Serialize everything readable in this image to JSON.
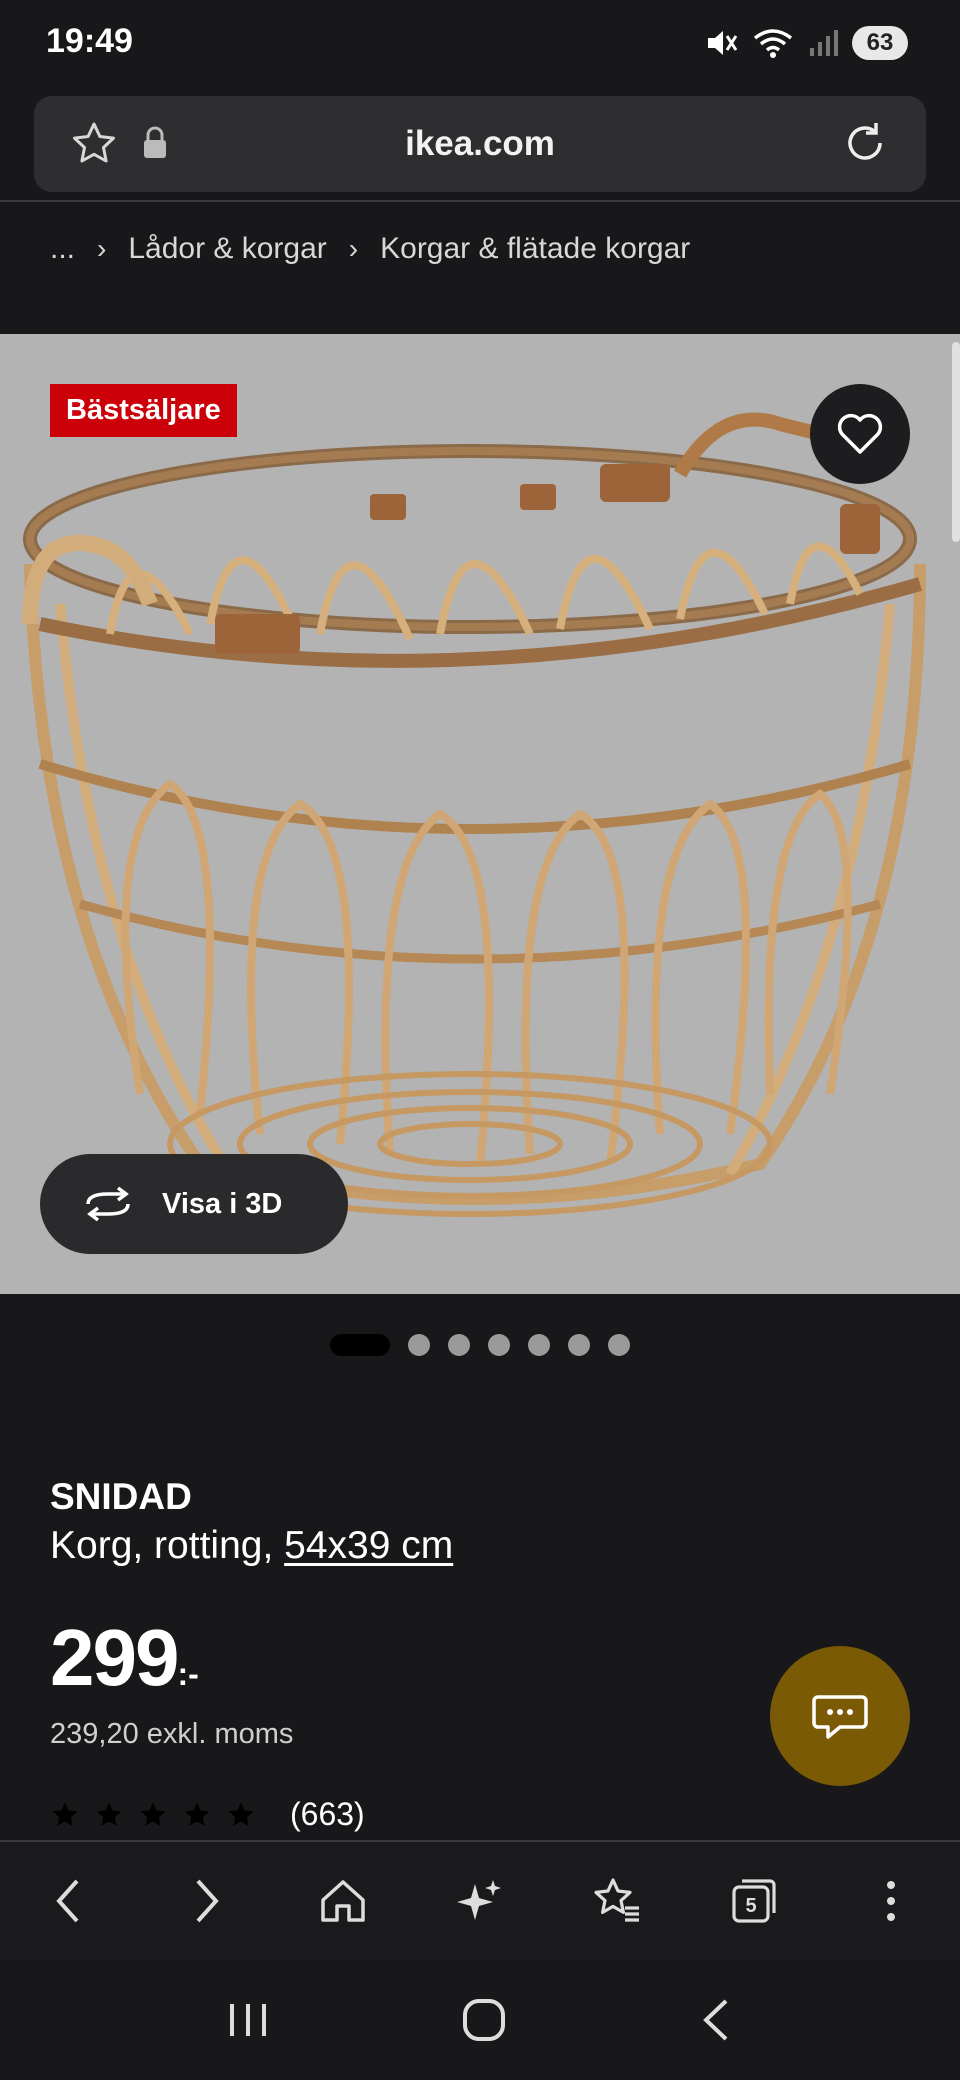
{
  "status_bar": {
    "time": "19:49",
    "battery": "63"
  },
  "browser": {
    "url": "ikea.com"
  },
  "breadcrumb": {
    "ellipsis": "...",
    "items": [
      "Lådor & korgar",
      "Korgar & flätade korgar"
    ]
  },
  "gallery": {
    "badge": "Bästsäljare",
    "view_3d_label": "Visa i 3D",
    "image_count": 7,
    "active_index": 0
  },
  "product": {
    "name": "SNIDAD",
    "description": "Korg, rotting, ",
    "size_link": "54x39 cm",
    "price": "299",
    "price_suffix": ":-",
    "price_ex_vat": "239,20 exkl. moms",
    "rating_stars": 5,
    "review_count": "(663)"
  },
  "browser_nav": {
    "tabs_count": "5"
  },
  "colors": {
    "background": "#18181a",
    "badge_red": "#cc0008",
    "chat_fab": "#7a5a05",
    "hero_bg": "#b3b3b3"
  },
  "icons": [
    "star-icon",
    "lock-icon",
    "reload-icon",
    "heart-icon",
    "rotate-3d-icon",
    "chat-icon",
    "back-icon",
    "forward-icon",
    "home-icon",
    "sparkle-icon",
    "bookmarks-icon",
    "tabs-icon",
    "menu-icon",
    "recents-icon",
    "home-circle-icon",
    "system-back-icon"
  ]
}
